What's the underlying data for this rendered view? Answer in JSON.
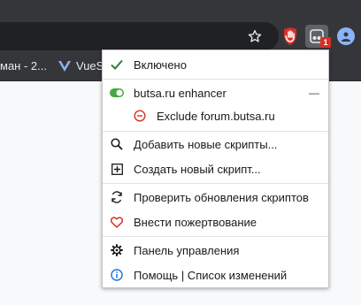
{
  "colors": {
    "toolbar_bg": "#35363a",
    "menu_text": "#1a1a1a",
    "check_green": "#2e7d32",
    "toggle_green": "#44a845",
    "exclude_red": "#d93025",
    "heart_red": "#d93025",
    "info_blue": "#1a73e8",
    "badge_red": "#d93025"
  },
  "toolbar": {
    "star_icon": "star-outline-icon",
    "ext_badge": "1"
  },
  "bookmarks": [
    {
      "label": "ман - 2..."
    },
    {
      "label": "VueS"
    }
  ],
  "menu": {
    "enabled_label": "Включено",
    "script": {
      "name": "butsa.ru enhancer",
      "toggle": "—",
      "exclude_label": "Exclude forum.butsa.ru"
    },
    "find_scripts": "Добавить новые скрипты...",
    "create_script": "Создать новый скрипт...",
    "check_updates": "Проверить обновления скриптов",
    "donate": "Внести пожертвование",
    "dashboard": "Панель управления",
    "help": "Помощь | Список изменений"
  }
}
